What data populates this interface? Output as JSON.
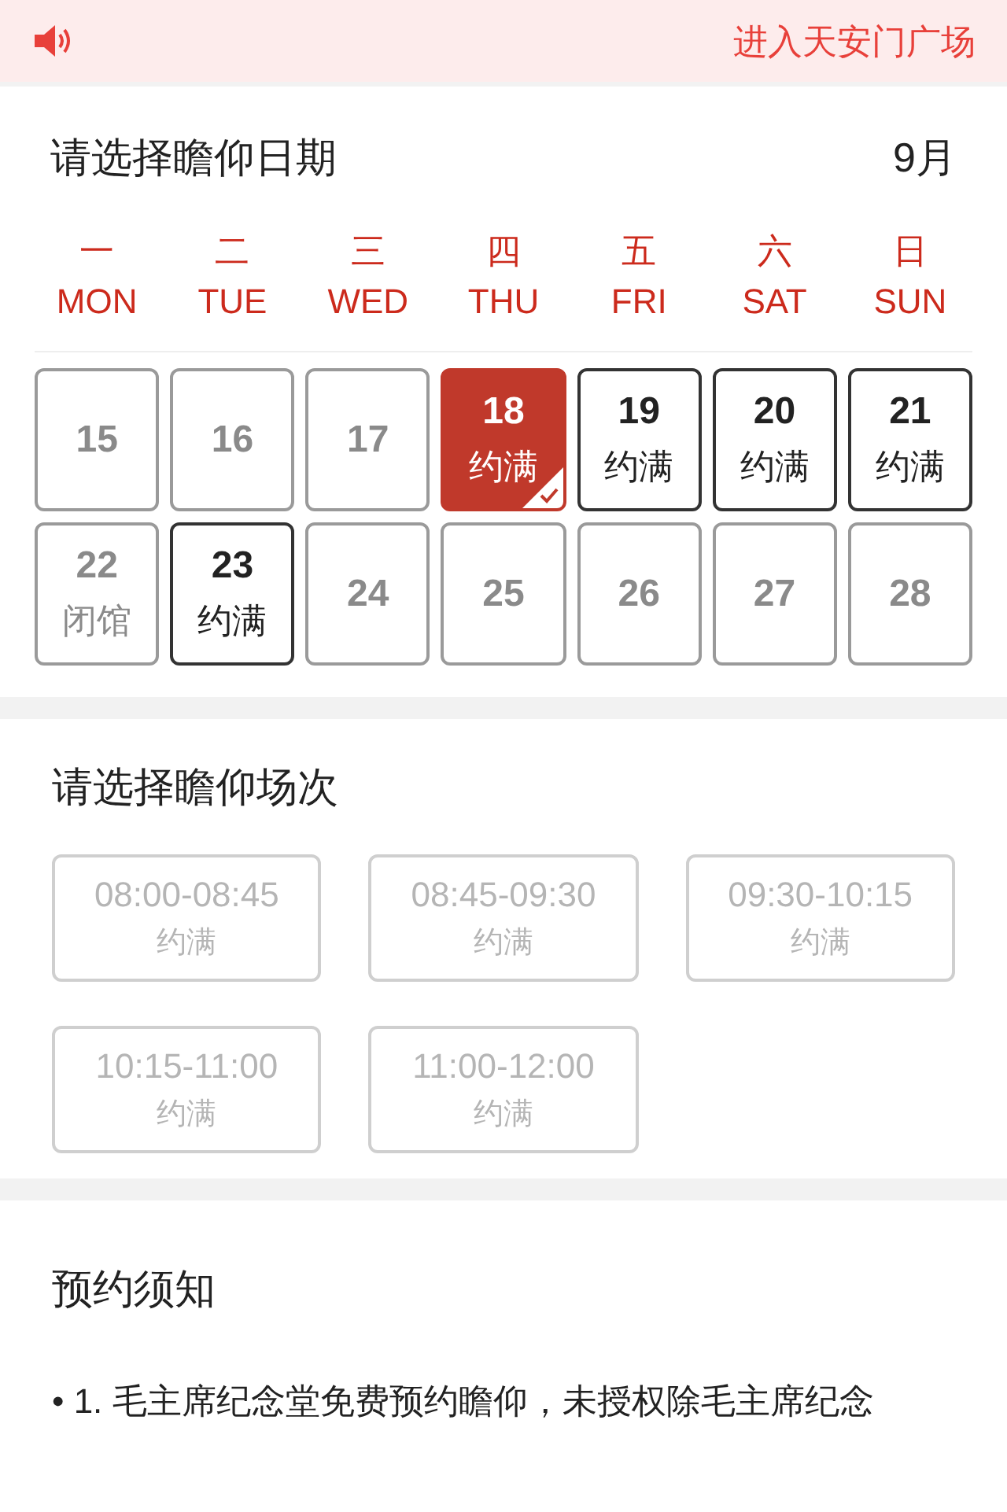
{
  "top_bar": {
    "link": "进入天安门广场"
  },
  "date_section": {
    "title": "请选择瞻仰日期",
    "month": "9月",
    "weekdays": [
      {
        "zh": "一",
        "en": "MON"
      },
      {
        "zh": "二",
        "en": "TUE"
      },
      {
        "zh": "三",
        "en": "WED"
      },
      {
        "zh": "四",
        "en": "THU"
      },
      {
        "zh": "五",
        "en": "FRI"
      },
      {
        "zh": "六",
        "en": "SAT"
      },
      {
        "zh": "日",
        "en": "SUN"
      }
    ],
    "days": [
      {
        "day": "15",
        "kind": "past",
        "selected": false
      },
      {
        "day": "16",
        "kind": "past",
        "selected": false
      },
      {
        "day": "17",
        "kind": "past",
        "selected": false
      },
      {
        "day": "18",
        "kind": "full",
        "note": "约满",
        "selected": true
      },
      {
        "day": "19",
        "kind": "full",
        "note": "约满",
        "selected": false
      },
      {
        "day": "20",
        "kind": "full",
        "note": "约满",
        "selected": false
      },
      {
        "day": "21",
        "kind": "full",
        "note": "约满",
        "selected": false
      },
      {
        "day": "22",
        "kind": "closed",
        "note": "闭馆",
        "selected": false
      },
      {
        "day": "23",
        "kind": "full",
        "note": "约满",
        "selected": false
      },
      {
        "day": "24",
        "kind": "past",
        "selected": false
      },
      {
        "day": "25",
        "kind": "past",
        "selected": false
      },
      {
        "day": "26",
        "kind": "past",
        "selected": false
      },
      {
        "day": "27",
        "kind": "past",
        "selected": false
      },
      {
        "day": "28",
        "kind": "past",
        "selected": false
      }
    ]
  },
  "session_section": {
    "title": "请选择瞻仰场次",
    "sessions": [
      {
        "time": "08:00-08:45",
        "status": "约满",
        "disabled": true
      },
      {
        "time": "08:45-09:30",
        "status": "约满",
        "disabled": true
      },
      {
        "time": "09:30-10:15",
        "status": "约满",
        "disabled": true
      },
      {
        "time": "10:15-11:00",
        "status": "约满",
        "disabled": true
      },
      {
        "time": "11:00-12:00",
        "status": "约满",
        "disabled": true
      }
    ]
  },
  "notice_section": {
    "title": "预约须知",
    "items": [
      "• 1.  毛主席纪念堂免费预约瞻仰，未授权除毛主席纪念"
    ]
  }
}
